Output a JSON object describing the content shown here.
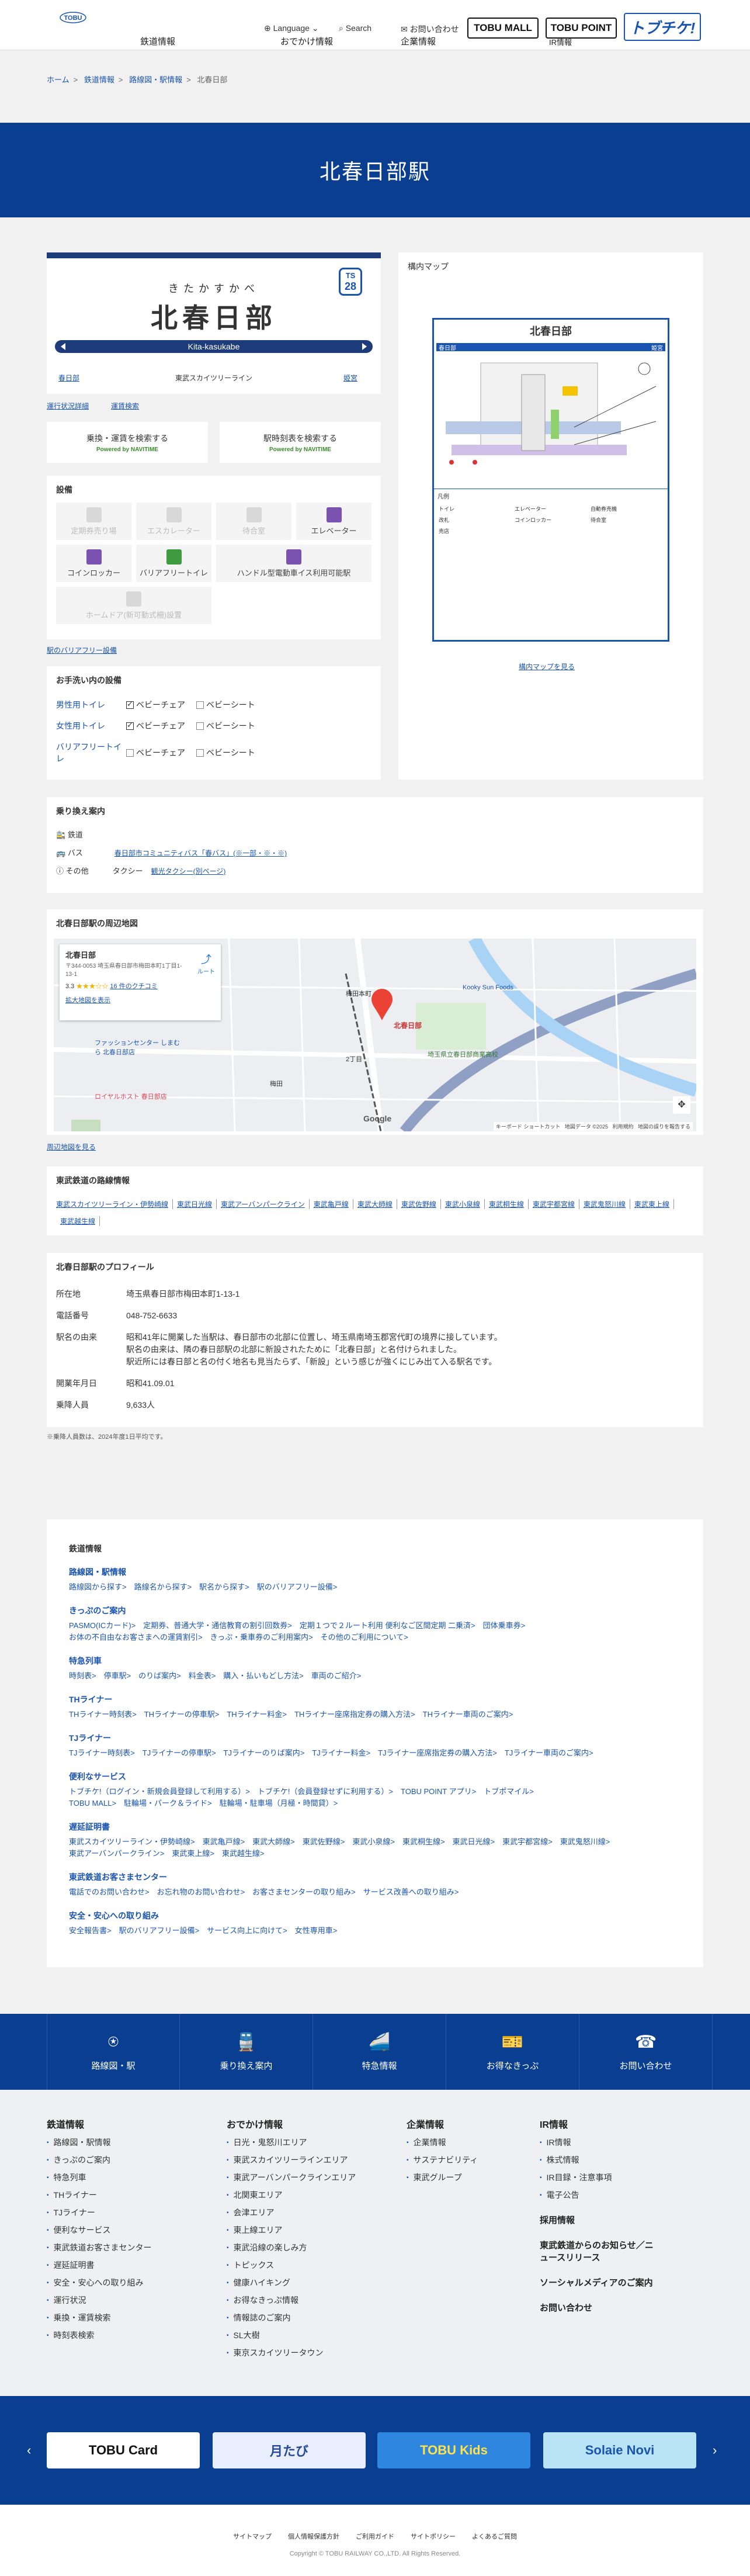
{
  "header": {
    "nav": [
      "鉄道情報",
      "おでかけ情報",
      "企業情報"
    ],
    "language": "Language",
    "search": "Search",
    "contact": "お問い合わせ",
    "ir": "IR情報",
    "logo_text": "TOBU",
    "tobu_mall": "TOBU MALL",
    "tobu_point": "TOBU POINT",
    "tobufreeway": "トブチケ!"
  },
  "breadcrumb": [
    "ホーム",
    "鉄道情報",
    "路線図・駅情報",
    "北春日部"
  ],
  "page_title": "北春日部駅",
  "station": {
    "badge_line": "TS",
    "badge_num": "28",
    "kana": "きたかすかべ",
    "name": "北春日部",
    "roman": "Kita-kasukabe",
    "prev": "春日部",
    "line": "東武スカイツリーライン",
    "next": "姫宮"
  },
  "links": {
    "service_status": "運行状況詳細",
    "service_code": "運賃検索",
    "barrier_free_map": "駅のバリアフリー設備",
    "map_large": "構内マップを見る",
    "nearby_large": "周辺地図を見る"
  },
  "search": {
    "fare": "乗換・運賃を検索する",
    "timetable": "駅時刻表を検索する",
    "powered": "Powered by NAVITIME"
  },
  "facilities": {
    "title": "設備",
    "items": [
      "定期券売り場",
      "エスカレーター",
      "待合室",
      "エレベーター",
      "コインロッカー",
      "バリアフリートイレ",
      "ハンドル型電動車イス利用可能駅",
      "ホームドア(新可動式柵)設置"
    ]
  },
  "toilets": {
    "title": "お手洗い内の設備",
    "rows": [
      {
        "label": "男性用トイレ",
        "a": "ベビーチェア",
        "b": "ベビーシート"
      },
      {
        "label": "女性用トイレ",
        "a": "ベビーチェア",
        "b": "ベビーシート"
      },
      {
        "label": "バリアフリートイレ",
        "a": "ベビーチェア",
        "b": "ベビーシート"
      }
    ]
  },
  "station_map": {
    "title": "構内マップ",
    "name": "北春日部",
    "legend": "凡例",
    "platform_names": [
      "春日部",
      "姫宮"
    ],
    "items": [
      "トイレ",
      "エレベーター",
      "自動券売機",
      "改札",
      "コインロッカー",
      "待合室",
      "売店"
    ]
  },
  "transfer": {
    "title": "乗り換え案内",
    "rail_label": "鉄道",
    "bus_label": "バス",
    "bus_link": "春日部市コミュニティバス「春バス」(※一部・※・※)",
    "other_label": "その他",
    "taxi": "タクシー",
    "sightseeing": "観光タクシー(別ページ)"
  },
  "nearby": {
    "title": "北春日部駅の周辺地図",
    "place": "北春日部",
    "address": "〒344-0053 埼玉県春日部市梅田本町1丁目1-13-1",
    "rating": "3.3",
    "reviews": "16 件のクチコミ",
    "route": "ルート",
    "enlarge": "拡大地図を表示",
    "labels": [
      "北春日部",
      "埼玉県立春日部商業高校",
      "梅田本町",
      "Kooky Sun Foods",
      "ファッションセンター しまむら 北春日部店",
      "ロイヤルホスト 春日部店",
      "2丁目",
      "梅田"
    ],
    "google": "Google",
    "footer": "キーボード ショートカット   地図データ ©2025   利用規約   地図の誤りを報告する"
  },
  "routes": {
    "title": "東武鉄道の路線情報",
    "items": [
      "東武スカイツリーライン・伊勢崎線",
      "東武日光線",
      "東武アーバンパークライン",
      "東武亀戸線",
      "東武大師線",
      "東武佐野線",
      "東武小泉線",
      "東武桐生線",
      "東武宇都宮線",
      "東武鬼怒川線",
      "東武東上線",
      "東武越生線"
    ]
  },
  "profile": {
    "title": "北春日部駅のプロフィール",
    "rows": [
      {
        "k": "所在地",
        "v": "埼玉県春日部市梅田本町1-13-1"
      },
      {
        "k": "電話番号",
        "v": "048-752-6633"
      },
      {
        "k": "駅名の由来",
        "v": "昭和41年に開業した当駅は、春日部市の北部に位置し、埼玉県南埼玉郡宮代町の境界に接しています。\n駅名の由来は、隣の春日部駅の北部に新設されたために「北春日部」と名付けられました。\n駅近所には春日部と名の付く地名も見当たらず、「新設」という感じが強くにじみ出て入る駅名です。"
      },
      {
        "k": "開業年月日",
        "v": "昭和41.09.01"
      },
      {
        "k": "乗降人員",
        "v": "9,633人"
      }
    ],
    "note": "※乗降人員数は、2024年度1日平均です。"
  },
  "sitemap": {
    "title": "鉄道情報",
    "groups": [
      {
        "h": "路線図・駅情報",
        "items": "路線図から探す>　路線名から探す>　駅名から探す>　駅のバリアフリー設備>"
      },
      {
        "h": "きっぷのご案内",
        "items": "PASMO(ICカード)>　定期券、普通大学・通信教育の割引回数券>　定期１つで２ルート利用 便利なご区間定期 二乗済>　団体乗車券>\nお体の不自由なお客さまへの運賃割引>　きっぷ・乗車券のご利用案内>　その他のご利用について>"
      },
      {
        "h": "特急列車",
        "items": "時刻表>　停車駅>　のりば案内>　料金表>　購入・払いもどし方法>　車両のご紹介>"
      },
      {
        "h": "THライナー",
        "items": "THライナー時刻表>　THライナーの停車駅>　THライナー料金>　THライナー座席指定券の購入方法>　THライナー車両のご案内>"
      },
      {
        "h": "TJライナー",
        "items": "TJライナー時刻表>　TJライナーの停車駅>　TJライナーのりば案内>　TJライナー料金>　TJライナー座席指定券の購入方法>　TJライナー車両のご案内>"
      },
      {
        "h": "便利なサービス",
        "items": "トブチケ!（ログイン・新規会員登録して利用する）>　トブチケ!（会員登録せずに利用する）>　TOBU POINT アプリ>　トブポマイル>\nTOBU MALL>　駐輪場・パーク＆ライド>　駐輪場・駐車場（月極・時間貸）>"
      },
      {
        "h": "遅延証明書",
        "items": "東武スカイツリーライン・伊勢崎線>　東武亀戸線>　東武大師線>　東武佐野線>　東武小泉線>　東武桐生線>　東武日光線>　東武宇都宮線>　東武鬼怒川線>\n東武アーバンパークライン>　東武東上線>　東武越生線>"
      },
      {
        "h": "東武鉄道お客さまセンター",
        "items": "電話でのお問い合わせ>　お忘れ物のお問い合わせ>　お客さまセンターの取り組み>　サービス改善への取り組み>"
      },
      {
        "h": "安全・安心への取り組み",
        "items": "安全報告書>　駅のバリアフリー設備>　サービス向上に向けて>　女性専用車>"
      }
    ]
  },
  "iconbar": [
    "路線図・駅",
    "乗り換え案内",
    "特急情報",
    "お得なきっぷ",
    "お問い合わせ"
  ],
  "footer": {
    "cols": [
      {
        "h": "鉄道情報",
        "items": [
          "路線図・駅情報",
          "きっぷのご案内",
          "特急列車",
          "THライナー",
          "TJライナー",
          "便利なサービス",
          "東武鉄道お客さまセンター",
          "遅延証明書",
          "安全・安心への取り組み",
          "運行状況",
          "乗換・運賃検索",
          "時刻表検索"
        ]
      },
      {
        "h": "おでかけ情報",
        "items": [
          "日光・鬼怒川エリア",
          "東武スカイツリーラインエリア",
          "東武アーバンパークラインエリア",
          "北関東エリア",
          "会津エリア",
          "東上線エリア",
          "東武沿線の楽しみ方",
          "トピックス",
          "健康ハイキング",
          "お得なきっぷ情報",
          "情報誌のご案内",
          "SL大樹",
          "東京スカイツリータウン"
        ]
      },
      {
        "h": "企業情報",
        "items": [
          "企業情報",
          "サステナビリティ",
          "東武グループ"
        ]
      },
      {
        "h": "IR情報",
        "items": [
          "IR情報",
          "株式情報",
          "IR目録・注意事項",
          "電子公告"
        ]
      }
    ],
    "extra": [
      "採用情報",
      "東武鉄道からのお知らせ／ニュースリリース",
      "ソーシャルメディアのご案内",
      "お問い合わせ"
    ]
  },
  "banners": [
    "TOBU Card",
    "月たび",
    "TOBU Kids",
    "Solaie Novi"
  ],
  "bottom_links": [
    "サイトマップ",
    "個人情報保護方針",
    "ご利用ガイド",
    "サイトポリシー",
    "よくあるご質問"
  ],
  "copyright": "Copyright © TOBU RAILWAY CO.,LTD. All Rights Reserved.",
  "colors": {
    "brand": "#0a3e91",
    "accent": "#1a54b1",
    "line": "#1f3c7a"
  }
}
